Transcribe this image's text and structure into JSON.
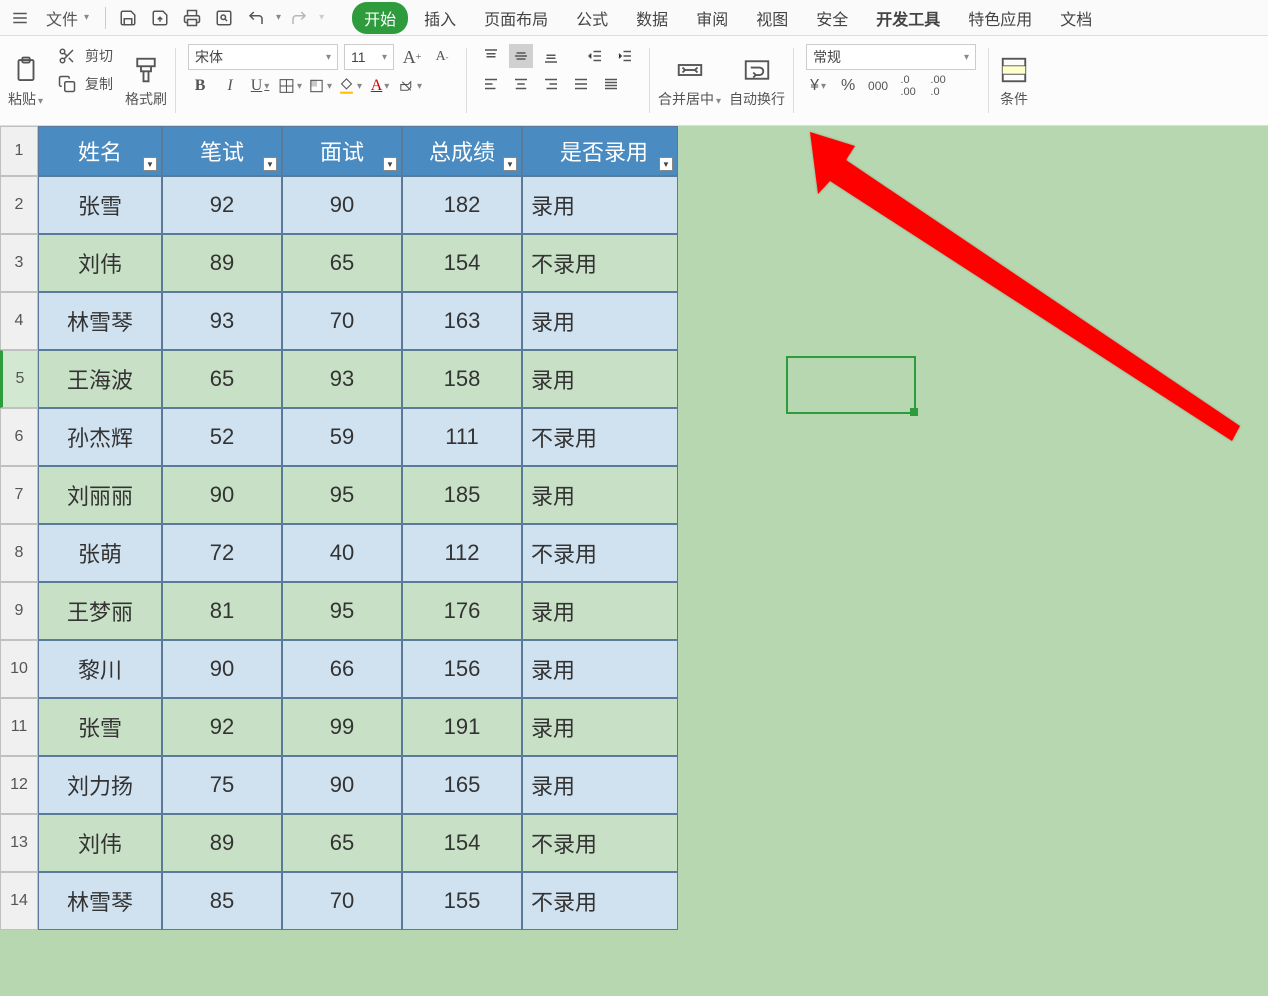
{
  "menu": {
    "file": "文件",
    "tabs": [
      "开始",
      "插入",
      "页面布局",
      "公式",
      "数据",
      "审阅",
      "视图",
      "安全",
      "开发工具",
      "特色应用",
      "文档"
    ]
  },
  "ribbon": {
    "paste": "粘贴",
    "cut": "剪切",
    "copy": "复制",
    "format_painter": "格式刷",
    "font_name": "宋体",
    "font_size": "11",
    "merge_center": "合并居中",
    "wrap_text": "自动换行",
    "number_format": "常规",
    "conditional_fmt": "条件"
  },
  "table": {
    "headers": [
      "姓名",
      "笔试",
      "面试",
      "总成绩",
      "是否录用"
    ],
    "rows": [
      {
        "name": "张雪",
        "written": "92",
        "interview": "90",
        "total": "182",
        "result": "录用",
        "style": "blue"
      },
      {
        "name": "刘伟",
        "written": "89",
        "interview": "65",
        "total": "154",
        "result": "不录用",
        "style": "green"
      },
      {
        "name": "林雪琴",
        "written": "93",
        "interview": "70",
        "total": "163",
        "result": "录用",
        "style": "blue"
      },
      {
        "name": "王海波",
        "written": "65",
        "interview": "93",
        "total": "158",
        "result": "录用",
        "style": "green"
      },
      {
        "name": "孙杰辉",
        "written": "52",
        "interview": "59",
        "total": "111",
        "result": "不录用",
        "style": "blue"
      },
      {
        "name": "刘丽丽",
        "written": "90",
        "interview": "95",
        "total": "185",
        "result": "录用",
        "style": "green"
      },
      {
        "name": "张萌",
        "written": "72",
        "interview": "40",
        "total": "112",
        "result": "不录用",
        "style": "blue"
      },
      {
        "name": "王梦丽",
        "written": "81",
        "interview": "95",
        "total": "176",
        "result": "录用",
        "style": "green"
      },
      {
        "name": "黎川",
        "written": "90",
        "interview": "66",
        "total": "156",
        "result": "录用",
        "style": "blue"
      },
      {
        "name": "张雪",
        "written": "92",
        "interview": "99",
        "total": "191",
        "result": "录用",
        "style": "green"
      },
      {
        "name": "刘力扬",
        "written": "75",
        "interview": "90",
        "total": "165",
        "result": "录用",
        "style": "blue"
      },
      {
        "name": "刘伟",
        "written": "89",
        "interview": "65",
        "total": "154",
        "result": "不录用",
        "style": "green"
      },
      {
        "name": "林雪琴",
        "written": "85",
        "interview": "70",
        "total": "155",
        "result": "不录用",
        "style": "blue"
      }
    ],
    "row_numbers": [
      "1",
      "2",
      "3",
      "4",
      "5",
      "6",
      "7",
      "8",
      "9",
      "10",
      "11",
      "12",
      "13",
      "14"
    ],
    "selected_row_index": 4
  }
}
